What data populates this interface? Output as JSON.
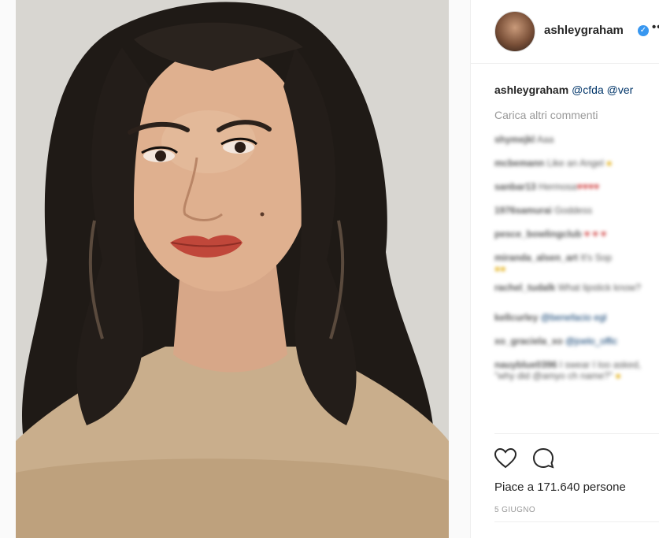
{
  "post": {
    "username": "ashleygraham",
    "more_label": "•••",
    "caption_user": "ashleygraham",
    "caption_text": "@cfda @ver",
    "load_more": "Carica altri commenti",
    "comments": [
      {
        "user": "shymejkl",
        "text": "Aaa"
      },
      {
        "user": "mcbemann",
        "text": "Like an Angel"
      },
      {
        "user": "sanbar13",
        "text": "Hermosa"
      },
      {
        "user": "1976samurai",
        "text": "Goddess"
      },
      {
        "user": "pesce_bowlingclub",
        "text": ""
      },
      {
        "user": "miranda_alsen_art",
        "text": "It's Sop"
      },
      {
        "user": "rachel_tudalk",
        "text": "What lipstick know?"
      },
      {
        "user": "kellcurley",
        "text": "@benefacio egl"
      },
      {
        "user": "xo_graciela_xo",
        "text": "@joelo_offic"
      },
      {
        "user": "nauyblue0396",
        "text": "I swear I loo asked, \"why did @amyo ch name?\""
      }
    ],
    "likes_text": "Piace a 171.640 persone",
    "date": "5 GIUGNO"
  },
  "colors": {
    "accent": "#3897f0",
    "text": "#262626",
    "muted": "#999999",
    "lips": "#c0473a"
  },
  "icons": {
    "verified": "verified-badge-icon",
    "like": "heart-icon",
    "comment": "comment-icon"
  }
}
